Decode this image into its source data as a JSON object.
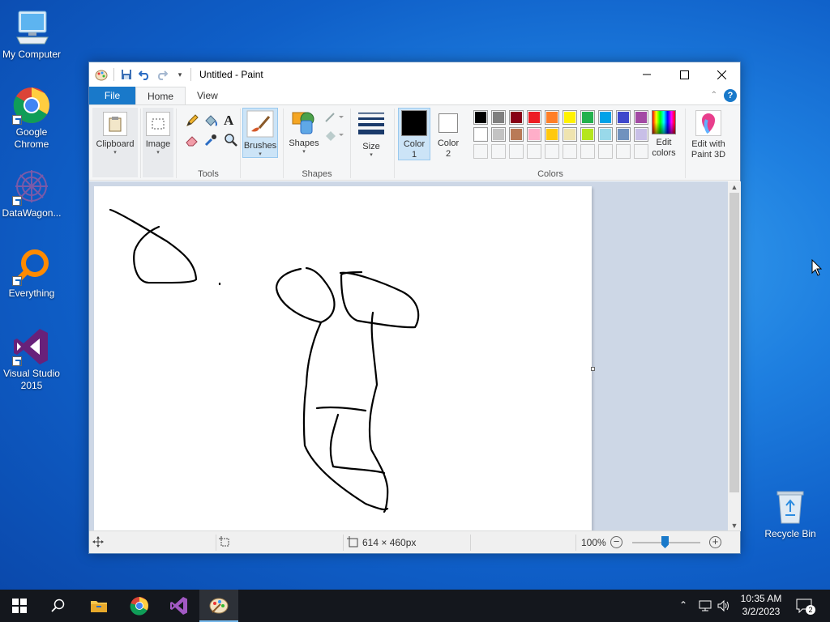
{
  "desktop": {
    "icons": [
      {
        "label": "My Computer"
      },
      {
        "label": "Google Chrome"
      },
      {
        "label": "DataWagon..."
      },
      {
        "label": "Everything"
      },
      {
        "label": "Visual Studio 2015"
      },
      {
        "label": "Recycle Bin"
      }
    ]
  },
  "window": {
    "title": "Untitled - Paint",
    "tabs": [
      {
        "label": "File"
      },
      {
        "label": "Home"
      },
      {
        "label": "View"
      }
    ],
    "help": "?"
  },
  "ribbon": {
    "clipboard": "Clipboard",
    "image": "Image",
    "tools_label": "Tools",
    "brushes": "Brushes",
    "shapes": "Shapes",
    "shapes_group": "Shapes",
    "size": "Size",
    "color1_line1": "Color",
    "color1_line2": "1",
    "color2_line1": "Color",
    "color2_line2": "2",
    "colors_group": "Colors",
    "edit_colors_line1": "Edit",
    "edit_colors_line2": "colors",
    "paint3d_line1": "Edit with",
    "paint3d_line2": "Paint 3D",
    "palette_row1": [
      "#000000",
      "#7f7f7f",
      "#880015",
      "#ed1c24",
      "#ff7f27",
      "#fff200",
      "#22b14c",
      "#00a2e8",
      "#3f48cc",
      "#a349a4"
    ],
    "palette_row2": [
      "#ffffff",
      "#c3c3c3",
      "#b97a57",
      "#ffaec9",
      "#ffc90e",
      "#efe4b0",
      "#b5e61d",
      "#99d9ea",
      "#7092be",
      "#c8bfe7"
    ],
    "color1": "#000000",
    "color2": "#ffffff",
    "accent": "#1979ca"
  },
  "status": {
    "canvas_size": "614 × 460px",
    "zoom": "100%",
    "zoom_minus": "−",
    "zoom_plus": "+"
  },
  "taskbar": {
    "time": "10:35 AM",
    "date": "3/2/2023",
    "notifications": "2"
  }
}
